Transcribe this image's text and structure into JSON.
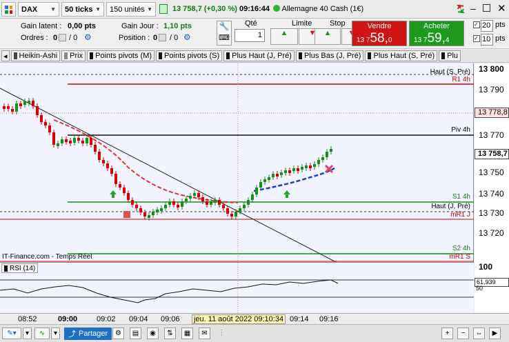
{
  "toolbar": {
    "instrument": "DAX",
    "ticks": "50 ticks",
    "units": "150 unités",
    "price": "13 758,7",
    "change": "(+0,30 %)",
    "time": "09:16:44",
    "market": "Allemagne 40 Cash (1€)"
  },
  "info": {
    "gain_latent_label": "Gain latent :",
    "gain_latent": "0,00 pts",
    "gain_jour_label": "Gain Jour :",
    "gain_jour": "1,10 pts",
    "ordres_label": "Ordres :",
    "ordres_a": "0",
    "ordres_b": "/ 0",
    "position_label": "Position :",
    "position_a": "0",
    "position_b": "/ 0",
    "qte_label": "Qté",
    "qte_value": "1",
    "limite_label": "Limite",
    "stop_label": "Stop",
    "vendre_label": "Vendre",
    "vendre_prefix": "13 7",
    "vendre_big": "58,",
    "vendre_suffix": "0",
    "acheter_label": "Acheter",
    "acheter_prefix": "13 7",
    "acheter_big": "59,",
    "acheter_suffix": "4",
    "l_label": "L",
    "l_value": "20",
    "l_unit": "pts",
    "s_label": "S",
    "s_value": "10",
    "s_unit": "pts"
  },
  "tabs": [
    "Heikin-Ashi",
    "Prix",
    "Points pivots (M)",
    "Points pivots (S)",
    "Plus Haut (J, Pré)",
    "Plus Bas (J, Pré)",
    "Plus Haut (S, Pré)",
    "Plu"
  ],
  "levels": {
    "haut_s": "Haut (S, Pré)",
    "r1": "R1 4h",
    "piv": "Piv 4h",
    "s1": "S1 4h",
    "haut_j": "Haut (J, Pré)",
    "mr1j": "mR1 J",
    "s2": "S2 4h",
    "mr1s": "mR1 S"
  },
  "source": "IT-Finance.com - Temps Réel",
  "rsi": {
    "label": "RSI (14)",
    "value": "61,939",
    "level_100": "100",
    "level_50": "50"
  },
  "yaxis": {
    "labels": [
      "13 800",
      "13 790",
      "13 770",
      "13 750",
      "13 740",
      "13 730",
      "13 720"
    ],
    "box_high": "13 778,8",
    "box_price": "13 758,7"
  },
  "xaxis": {
    "labels": [
      "08:52",
      "09:00",
      "09:02",
      "09:04",
      "09:06",
      "09:14",
      "09:16"
    ],
    "crosshair": "jeu. 11 août 2022 09:10:34"
  },
  "bottom": {
    "share": "Partager"
  },
  "colors": {
    "up": "#1a8c1a",
    "down": "#d40000",
    "vendre": "#d01414",
    "acheter": "#1d9a1d"
  }
}
